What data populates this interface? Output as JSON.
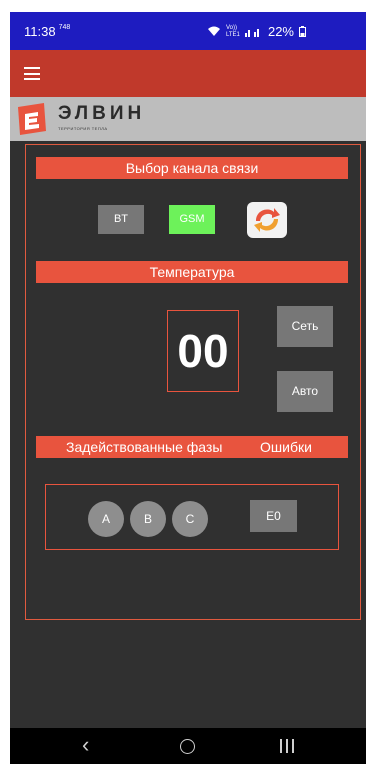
{
  "statusbar": {
    "time": "11:38",
    "time_sub": "748",
    "signal_text": "Vo)) LTE1",
    "battery": "22%"
  },
  "logo": {
    "text": "ЭЛВИН",
    "subtitle": "ТЕРРИТОРИЯ ТЕПЛА"
  },
  "channel": {
    "heading": "Выбор канала связи",
    "bt_label": "BT",
    "gsm_label": "GSM"
  },
  "temperature": {
    "heading": "Температура",
    "value": "00",
    "net_label": "Сеть",
    "auto_label": "Авто"
  },
  "phases": {
    "heading": "Задействованные фазы",
    "errors_heading": "Ошибки",
    "items": [
      "A",
      "B",
      "C"
    ],
    "error_code": "E0"
  },
  "colors": {
    "statusbar": "#1e1cc0",
    "appbar": "#c0392b",
    "accent": "#e8543e",
    "gsm_active": "#6df25a",
    "background": "#303030"
  }
}
